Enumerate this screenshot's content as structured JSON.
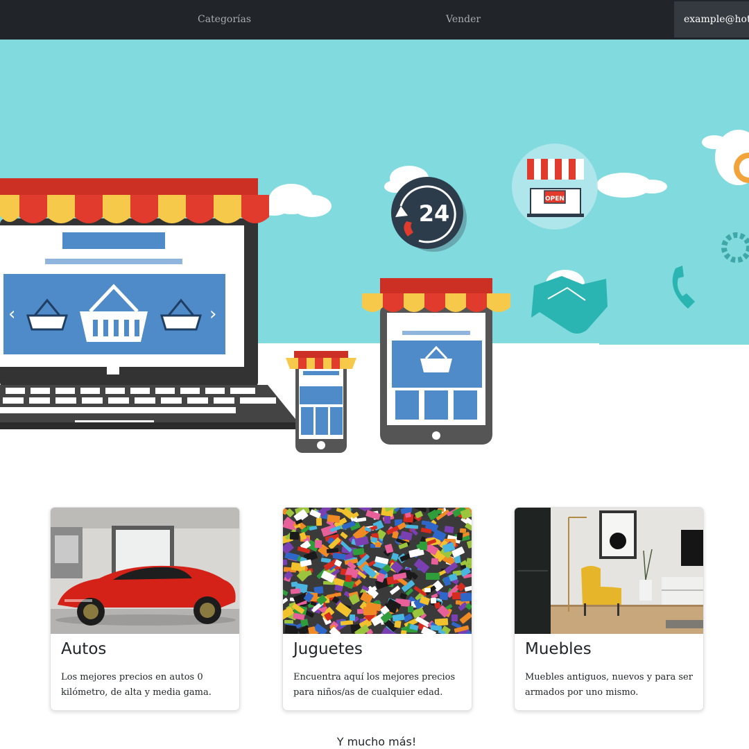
{
  "nav": {
    "categories_label": "Categorías",
    "sell_label": "Vender",
    "user_email": "example@hotm"
  },
  "hero": {
    "support_badge": "24",
    "open_sign": "OPEN",
    "colors": {
      "sky": "#80dade",
      "awning_red": "#e03b2c",
      "awning_yellow": "#f7c94a",
      "screen_blue": "#4f8bc9"
    }
  },
  "cards": [
    {
      "title": "Autos",
      "text": "Los mejores precios en autos 0 kilómetro, de alta y media gama.",
      "image": "red-sports-car-photo"
    },
    {
      "title": "Juguetes",
      "text": "Encuentra aquí los mejores precios para niños/as de cualquier edad.",
      "image": "colorful-toy-bricks-photo"
    },
    {
      "title": "Muebles",
      "text": "Muebles antiguos, nuevos y para ser armados por uno mismo.",
      "image": "yellow-armchair-room-photo"
    }
  ],
  "footer": {
    "more_label": "Y mucho más!"
  }
}
